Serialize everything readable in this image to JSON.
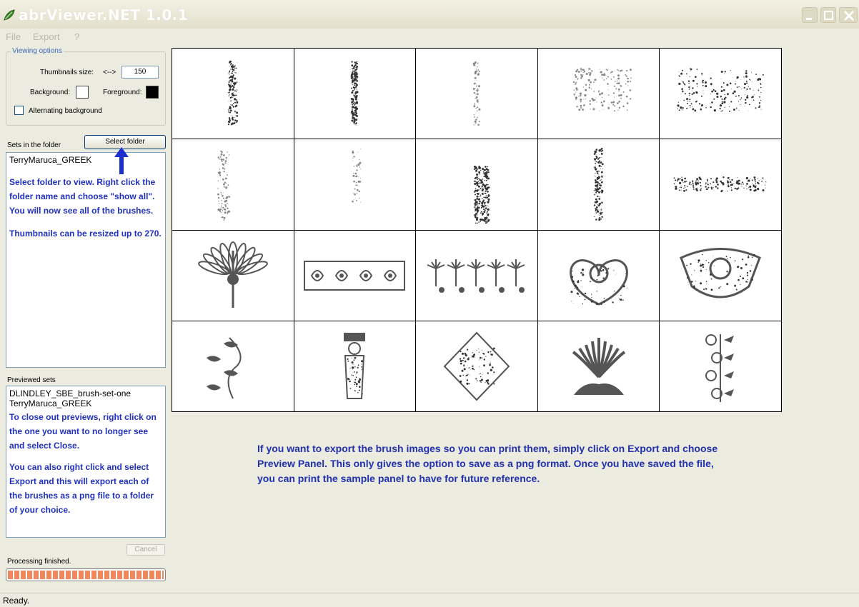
{
  "window": {
    "title": "abrViewer.NET 1.0.1"
  },
  "menu": [
    "File",
    "Export",
    "?"
  ],
  "viewing_options": {
    "legend": "Viewing options",
    "thumb_label": "Thumbnails size:",
    "arrow_glyph": "<-->",
    "thumb_value": "150",
    "background_label": "Background:",
    "foreground_label": "Foreground:",
    "background_color": "#ffffff",
    "foreground_color": "#000000",
    "alternating_label": "Alternating background",
    "alternating_checked": false
  },
  "sets": {
    "label": "Sets in the folder",
    "select_folder_button": "Select folder",
    "items": [
      "TerryMaruca_GREEK"
    ],
    "note1": "Select folder to view. Right click the folder name and choose \"show all\". You will now see all of the brushes.",
    "note2": "Thumbnails can be resized up to 270."
  },
  "previewed": {
    "label": "Previewed sets",
    "items": [
      "DLINDLEY_SBE_brush-set-one",
      "TerryMaruca_GREEK"
    ],
    "note1": "To close out previews, right click on the one you want to no longer see and select Close.",
    "note2": "You can also right click and select Export and this will export each of the brushes as a png file to a folder of your choice."
  },
  "cancel_button": "Cancel",
  "processing": {
    "status": "Processing finished.",
    "progress": 1.0
  },
  "info_text": "If you want to export the brush images so you can print them, simply click on Export and choose Preview Panel. This only gives the option to save as a png format. Once you have saved the file, you can print the sample panel to have for future reference.",
  "statusbar": {
    "text": "Ready."
  },
  "thumbnails": [
    "grunge-vertical-streak-brush",
    "grunge-vertical-stroke-brush",
    "faint-vertical-speckle-brush",
    "scattered-dust-brush",
    "scattered-speckle-brush",
    "vertical-edge-texture-brush",
    "faint-edge-texture-brush",
    "dense-vertical-grunge-brush",
    "vertical-stripe-grunge-brush",
    "horizontal-streak-brush",
    "greek-palmette-ornament-brush",
    "greek-border-frieze-brush",
    "floral-frieze-brush",
    "greek-heart-ornament-brush",
    "ornate-crest-brush",
    "floral-vine-brush",
    "caryatid-figure-brush",
    "diamond-ornament-brush",
    "anthemion-palmette-brush",
    "spiral-vine-brush"
  ],
  "colors": {
    "note_text": "#2030c0",
    "accent_arrow": "#1a2fd0",
    "progress": "#f0875c"
  }
}
